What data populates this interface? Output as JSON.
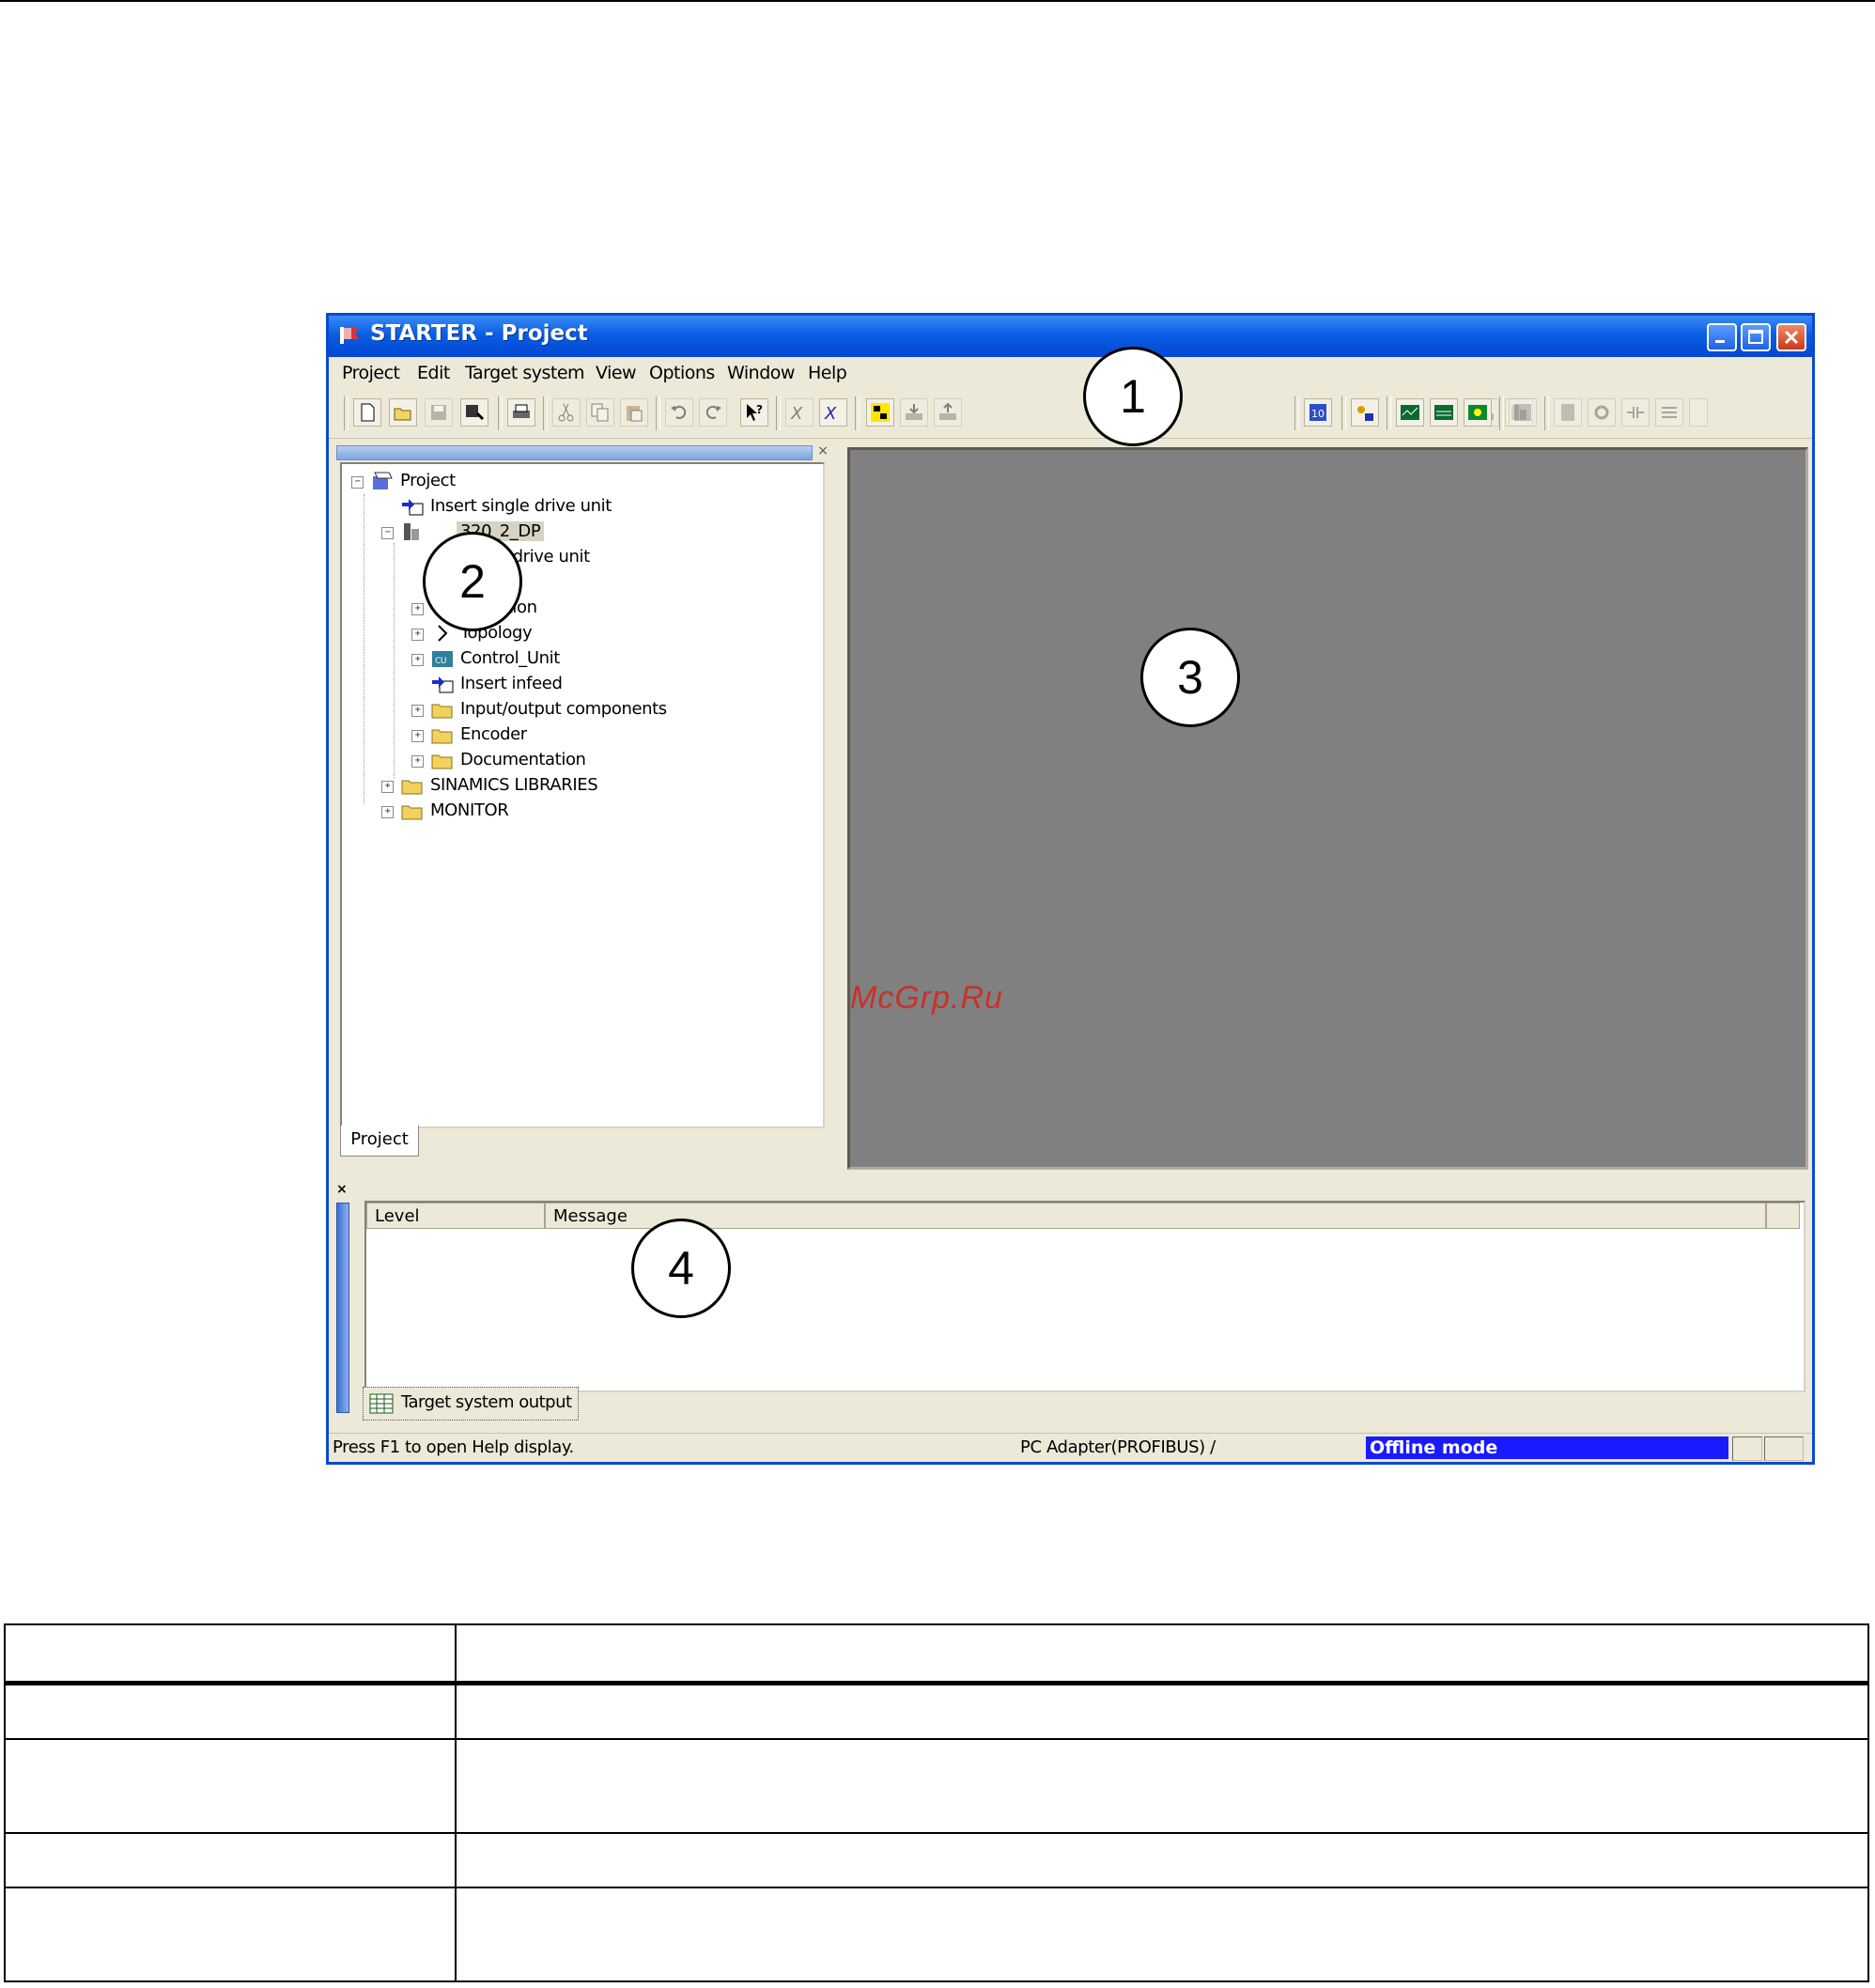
{
  "window": {
    "title": "STARTER - Project",
    "colors": {
      "titlebar": "#0a5ee4",
      "work_area": "#808080",
      "offline_mode": "#1a1aff",
      "watermark": "#c8312a"
    }
  },
  "menu": [
    "Project",
    "Edit",
    "Target system",
    "View",
    "Options",
    "Window",
    "Help"
  ],
  "toolbar_icons": [
    "new-icon",
    "open-icon",
    "save-icon",
    "save-compile-icon",
    "print-icon",
    "cut-icon",
    "copy-icon",
    "paste-icon",
    "undo-icon",
    "redo-icon",
    "help-pointer-icon",
    "expert-icon",
    "expert-list-icon",
    "connect-icon",
    "download-icon",
    "upload-icon",
    "control-panel-icon",
    "device-config-icon",
    "trace-icon",
    "measure-icon",
    "function-generator-icon"
  ],
  "tree": {
    "items": [
      {
        "label": "Project",
        "icon": "project-icon"
      },
      {
        "label": "Insert single drive unit",
        "icon": "insert-icon"
      },
      {
        "label": "CU320_2_DP",
        "visible_label": "320_2_DP",
        "icon": "drive-unit-icon"
      },
      {
        "label": "ure drive unit",
        "icon": "config-icon"
      },
      {
        "label": "ew",
        "icon": "overview-icon"
      },
      {
        "label": "unication",
        "icon": "communication-icon"
      },
      {
        "label": "Topology",
        "icon": "topology-icon"
      },
      {
        "label": "Control_Unit",
        "icon": "control-unit-icon"
      },
      {
        "label": "Insert infeed",
        "icon": "insert-icon"
      },
      {
        "label": "Input/output components",
        "icon": "folder-icon"
      },
      {
        "label": "Encoder",
        "icon": "folder-icon"
      },
      {
        "label": "Documentation",
        "icon": "folder-icon"
      },
      {
        "label": "SINAMICS LIBRARIES",
        "icon": "folder-icon"
      },
      {
        "label": "MONITOR",
        "icon": "folder-icon"
      }
    ],
    "tab": "Project"
  },
  "detail": {
    "columns": [
      "Level",
      "Message"
    ],
    "tab": "Target system output"
  },
  "status": {
    "help": "Press F1 to open Help display.",
    "adapter": "PC Adapter(PROFIBUS) /",
    "mode": "Offline mode"
  },
  "watermark": "McGrp.Ru",
  "callouts": [
    "1",
    "2",
    "3",
    "4"
  ]
}
